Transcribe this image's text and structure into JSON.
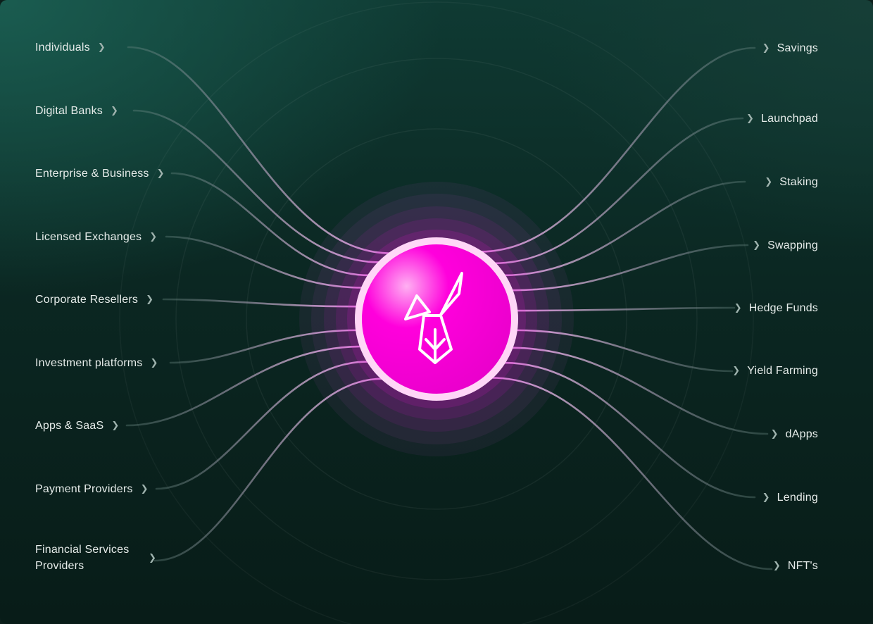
{
  "hub": {
    "logo_icon": "rabbit-logo-icon",
    "color": "#ff00dc",
    "ring_color": "#ffd2f6"
  },
  "colors": {
    "bg_top": "#1a5c50",
    "bg_bottom": "#081c18",
    "text": "#e6ecea",
    "line_near": "#f2b8ef",
    "line_far": "#6b8a84"
  },
  "left_items": [
    {
      "label": "Individuals"
    },
    {
      "label": "Digital Banks"
    },
    {
      "label": "Enterprise & Business"
    },
    {
      "label": "Licensed Exchanges"
    },
    {
      "label": "Corporate Resellers"
    },
    {
      "label": "Investment platforms"
    },
    {
      "label": "Apps & SaaS"
    },
    {
      "label": "Payment Providers"
    },
    {
      "label": "Financial Services Providers"
    }
  ],
  "right_items": [
    {
      "label": "Savings"
    },
    {
      "label": "Launchpad"
    },
    {
      "label": "Staking"
    },
    {
      "label": "Swapping"
    },
    {
      "label": "Hedge Funds"
    },
    {
      "label": "Yield Farming"
    },
    {
      "label": "dApps"
    },
    {
      "label": "Lending"
    },
    {
      "label": "NFT's"
    }
  ],
  "chevron_icon": "chevron-right-icon"
}
